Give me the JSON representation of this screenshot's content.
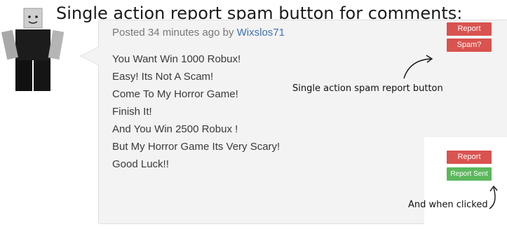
{
  "title": "Single action report spam button for comments:",
  "comment": {
    "meta_prefix": "Posted 34 minutes ago by ",
    "author": "Wixslos71",
    "lines": [
      "You Want Win 1000 Robux!",
      "Easy! Its Not A Scam!",
      "Come To My Horror Game!",
      "Finish It!",
      "And You Win 2500 Robux !",
      "But My Horror Game Its Very Scary!",
      "Good Luck!!"
    ]
  },
  "buttons": {
    "report_label": "Report",
    "spam_label": "Spam?",
    "report_clicked_label": "Report",
    "report_sent_label": "Report Sent"
  },
  "annotations": {
    "spam_button_note": "Single action spam report button",
    "clicked_note": "And when clicked"
  },
  "colors": {
    "report_red": "#d9534f",
    "report_sent_green": "#5cb85c",
    "author_link": "#3f72af",
    "card_bg": "#f3f3f3"
  }
}
